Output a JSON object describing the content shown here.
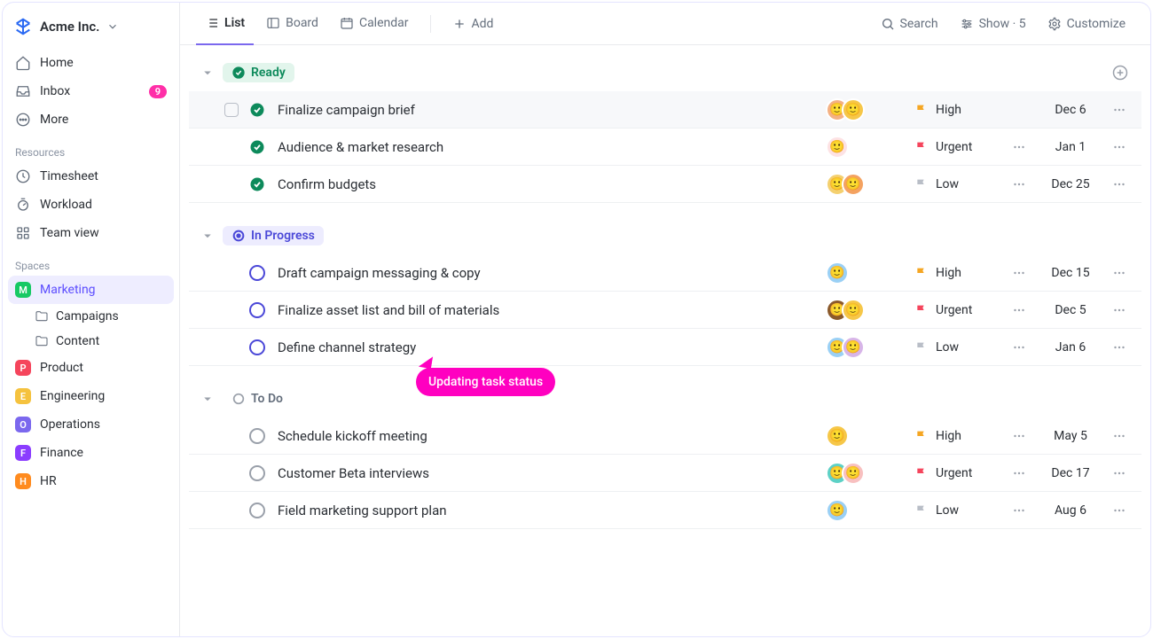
{
  "workspace": {
    "name": "Acme Inc."
  },
  "nav": {
    "home": "Home",
    "inbox": "Inbox",
    "inbox_badge": "9",
    "more": "More"
  },
  "resources": {
    "label": "Resources",
    "timesheet": "Timesheet",
    "workload": "Workload",
    "teamview": "Team view"
  },
  "spaces": {
    "label": "Spaces",
    "items": [
      {
        "key": "marketing",
        "initial": "M",
        "color": "#17c964",
        "name": "Marketing",
        "active": true
      },
      {
        "key": "product",
        "initial": "P",
        "color": "#f5455c",
        "name": "Product"
      },
      {
        "key": "engineering",
        "initial": "E",
        "color": "#f5c23e",
        "name": "Engineering"
      },
      {
        "key": "operations",
        "initial": "O",
        "color": "#7b68ee",
        "name": "Operations"
      },
      {
        "key": "finance",
        "initial": "F",
        "color": "#8b3dff",
        "name": "Finance"
      },
      {
        "key": "hr",
        "initial": "H",
        "color": "#ff8b1f",
        "name": "HR"
      }
    ],
    "sub": {
      "campaigns": "Campaigns",
      "content": "Content"
    }
  },
  "tabs": {
    "list": "List",
    "board": "Board",
    "calendar": "Calendar",
    "add": "Add"
  },
  "toolbar": {
    "search": "Search",
    "show": "Show · 5",
    "customize": "Customize"
  },
  "tooltip": "Updating task status",
  "priority": {
    "high": "High",
    "urgent": "Urgent",
    "low": "Low"
  },
  "groups": [
    {
      "key": "ready",
      "label": "Ready",
      "style": "ready",
      "plus": true,
      "tasks": [
        {
          "title": "Finalize campaign brief",
          "avatars": [
            "#f4b183",
            "#f6c748"
          ],
          "priority": "high",
          "flag": "#f5a623",
          "date": "Dec 6",
          "hover": true,
          "showCheck": true
        },
        {
          "title": "Audience & market research",
          "avatars": [
            "#fde2e4"
          ],
          "priority": "urgent",
          "flag": "#f5455c",
          "showAction": true,
          "date": "Jan 1"
        },
        {
          "title": "Confirm budgets",
          "avatars": [
            "#f4d06f",
            "#f4a261"
          ],
          "priority": "low",
          "flag": "#b9bec7",
          "showAction": true,
          "date": "Dec 25"
        }
      ]
    },
    {
      "key": "progress",
      "label": "In Progress",
      "style": "progress",
      "tasks": [
        {
          "title": "Draft campaign messaging & copy",
          "avatars": [
            "#9ad0f5"
          ],
          "priority": "high",
          "flag": "#f5a623",
          "showAction": true,
          "date": "Dec 15"
        },
        {
          "title": "Finalize asset list and bill of materials",
          "avatars": [
            "#8b5a2b",
            "#f6c748"
          ],
          "priority": "urgent",
          "flag": "#f5455c",
          "showAction": true,
          "date": "Dec 5"
        },
        {
          "title": "Define channel strategy",
          "avatars": [
            "#9ad0f5",
            "#d7b5e8"
          ],
          "priority": "low",
          "flag": "#b9bec7",
          "showAction": true,
          "date": "Jan 6"
        }
      ]
    },
    {
      "key": "todo",
      "label": "To Do",
      "style": "todo",
      "tasks": [
        {
          "title": "Schedule kickoff meeting",
          "avatars": [
            "#f6c748"
          ],
          "priority": "high",
          "flag": "#f5a623",
          "showAction": true,
          "date": "May 5"
        },
        {
          "title": "Customer Beta interviews",
          "avatars": [
            "#5dd1c6",
            "#f8c0c0"
          ],
          "priority": "urgent",
          "flag": "#f5455c",
          "showAction": true,
          "date": "Dec 17"
        },
        {
          "title": "Field marketing support plan",
          "avatars": [
            "#9ad0f5"
          ],
          "priority": "low",
          "flag": "#b9bec7",
          "showAction": true,
          "date": "Aug 6"
        }
      ]
    }
  ]
}
